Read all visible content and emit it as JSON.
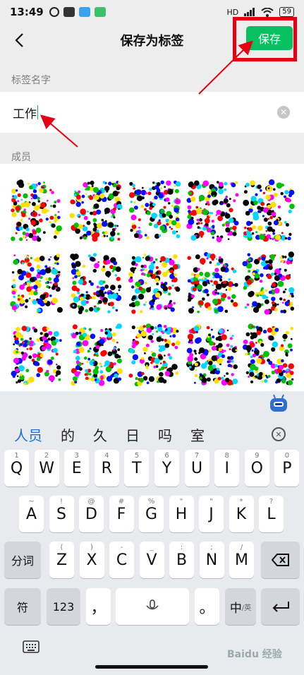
{
  "status": {
    "time": "13:49",
    "battery": "59",
    "network": "HD"
  },
  "nav": {
    "title": "保存为标签",
    "save_label": "保存"
  },
  "form": {
    "name_label": "标签名字",
    "name_value": "工作",
    "members_label": "成员"
  },
  "keyboard": {
    "candidates": [
      "人员",
      "的",
      "久",
      "日",
      "吗",
      "室"
    ],
    "row1": [
      {
        "k": "Q",
        "s": "1"
      },
      {
        "k": "W",
        "s": "2"
      },
      {
        "k": "E",
        "s": "3"
      },
      {
        "k": "R",
        "s": "4"
      },
      {
        "k": "T",
        "s": "5"
      },
      {
        "k": "Y",
        "s": "6"
      },
      {
        "k": "U",
        "s": "7"
      },
      {
        "k": "I",
        "s": "8"
      },
      {
        "k": "O",
        "s": "9"
      },
      {
        "k": "P",
        "s": "0"
      }
    ],
    "row2": [
      {
        "k": "A",
        "s": "~"
      },
      {
        "k": "S",
        "s": "!"
      },
      {
        "k": "D",
        "s": "@"
      },
      {
        "k": "F",
        "s": "#"
      },
      {
        "k": "G",
        "s": "%"
      },
      {
        "k": "H",
        "s": "\""
      },
      {
        "k": "J",
        "s": "\""
      },
      {
        "k": "K",
        "s": "*"
      },
      {
        "k": "L",
        "s": "?"
      }
    ],
    "row3": [
      {
        "k": "Z",
        "s": "("
      },
      {
        "k": "X",
        "s": ")"
      },
      {
        "k": "C",
        "s": "-"
      },
      {
        "k": "V",
        "s": "_"
      },
      {
        "k": "B",
        "s": ":"
      },
      {
        "k": "N",
        "s": ";"
      },
      {
        "k": "M",
        "s": "/"
      }
    ],
    "fenci": "分词",
    "fu": "符",
    "num": "123",
    "comma": "，",
    "period": "。",
    "lang_main": "中",
    "lang_sub": "/英"
  },
  "watermark": "Baidu 经验",
  "colors": {
    "accent": "#07c160",
    "highlight": "#e60012",
    "candidate": "#1f6fd6"
  },
  "icons": [
    "back-arrow-icon",
    "clear-icon",
    "microphone-icon",
    "backspace-icon",
    "enter-icon",
    "keyboard-icon",
    "robot-icon"
  ]
}
